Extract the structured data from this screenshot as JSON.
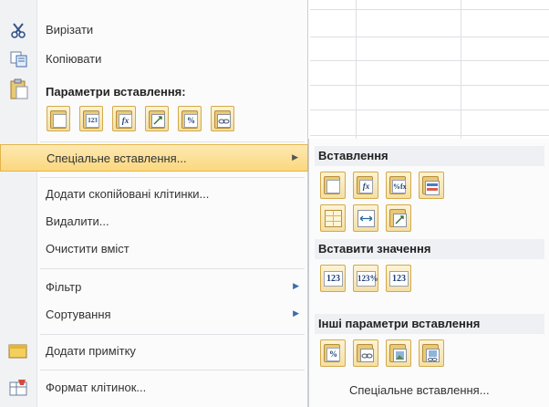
{
  "menu": {
    "cut_label": "Вирізати",
    "copy_label": "Копіювати",
    "paste_options_header": "Параметри вставлення:",
    "paste_options": [
      {
        "icon": "paste-icon",
        "glyph": ""
      },
      {
        "icon": "paste-values-icon",
        "glyph": "123"
      },
      {
        "icon": "paste-formulas-icon",
        "glyph": "fx"
      },
      {
        "icon": "paste-transpose-icon",
        "glyph": ""
      },
      {
        "icon": "paste-formatting-icon",
        "glyph": "%"
      },
      {
        "icon": "paste-link-icon",
        "glyph": ""
      }
    ],
    "paste_special_label": "Спеціальне вставлення...",
    "insert_copied_label": "Додати скопійовані клітинки...",
    "delete_label": "Видалити...",
    "clear_label": "Очистити вміст",
    "filter_label": "Фільтр",
    "sort_label": "Сортування",
    "add_comment_label": "Додати примітку",
    "format_cells_label": "Формат клітинок..."
  },
  "submenu": {
    "paste_header": "Вставлення",
    "paste_row1": [
      "paste-icon",
      "paste-formulas-icon",
      "paste-formulas-number-format-icon",
      "paste-keep-source-formatting-icon"
    ],
    "paste_row2": [
      "paste-no-borders-icon",
      "paste-keep-column-widths-icon",
      "paste-transpose-icon"
    ],
    "values_header": "Вставити значення",
    "values_row": [
      "paste-values-icon",
      "paste-values-number-format-icon",
      "paste-values-source-formatting-icon"
    ],
    "other_header": "Інші параметри вставлення",
    "other_row": [
      "paste-formatting-icon",
      "paste-link-icon",
      "paste-picture-icon",
      "paste-linked-picture-icon"
    ],
    "more_label": "Спеціальне вставлення..."
  },
  "colors": {
    "highlight": "#fbd77f",
    "accent_border": "#e4b44a"
  }
}
